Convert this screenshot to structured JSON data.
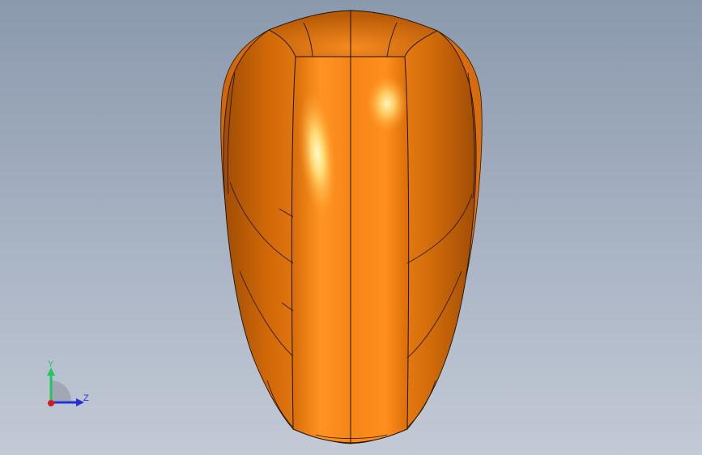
{
  "viewport": {
    "background_top": "#8b99ad",
    "background_bottom": "#c3cad6"
  },
  "model": {
    "icon": "orange-shell-part",
    "color_base": "#e07010",
    "color_highlight": "#fff2a0",
    "color_edge": "#1a1208"
  },
  "triad": {
    "y_label": "Y",
    "z_label": "Z",
    "y_color": "#22c55e",
    "z_color": "#2430d8",
    "x_color": "#d81c1c"
  }
}
